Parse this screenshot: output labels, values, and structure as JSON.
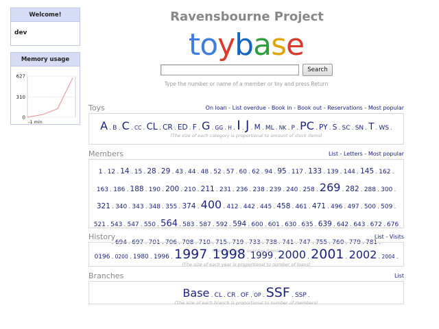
{
  "sidebar": {
    "welcome_title": "Welcome!",
    "user": "dev",
    "memory_title": "Memory usage"
  },
  "header": {
    "title": "Ravensbourne Project",
    "logo_letters": [
      "t",
      "o",
      "y",
      "b",
      "a",
      "s",
      "e"
    ],
    "logo_colors": [
      "#3f7de0",
      "#3f7de0",
      "#d93a2b",
      "#1565c0",
      "#2e9e3e",
      "#e0a400",
      "#d93a2b"
    ]
  },
  "search": {
    "value": "",
    "button_label": "Search",
    "hint": "Type the number or name of a member or toy and press Return"
  },
  "chart_data": {
    "type": "line",
    "title": "",
    "y_ticks": [
      "627",
      "310",
      "0"
    ],
    "x_ticks": [
      "-1 min"
    ],
    "ylim": [
      0,
      627
    ],
    "values": [
      0,
      40,
      130,
      600
    ]
  },
  "toys": {
    "title": "Toys",
    "links": [
      "On loan",
      "List overdue",
      "Book in",
      "Book out",
      "Reservations",
      "Most popular"
    ],
    "items": [
      {
        "t": "A",
        "s": 5
      },
      {
        "t": "B",
        "s": 2
      },
      {
        "t": "C",
        "s": 5
      },
      {
        "t": "CC",
        "s": 1
      },
      {
        "t": "CL",
        "s": 4
      },
      {
        "t": "CR",
        "s": 3
      },
      {
        "t": "ED",
        "s": 3
      },
      {
        "t": "F",
        "s": 3
      },
      {
        "t": "G",
        "s": 5
      },
      {
        "t": "GG",
        "s": 1
      },
      {
        "t": "H",
        "s": 1
      },
      {
        "t": "I",
        "s": 6
      },
      {
        "t": "J",
        "s": 6
      },
      {
        "t": "M",
        "s": 3
      },
      {
        "t": "ML",
        "s": 2
      },
      {
        "t": "NK",
        "s": 1
      },
      {
        "t": "P",
        "s": 2
      },
      {
        "t": "PC",
        "s": 5
      },
      {
        "t": "PY",
        "s": 3
      },
      {
        "t": "S",
        "s": 3
      },
      {
        "t": "SC",
        "s": 2
      },
      {
        "t": "SN",
        "s": 2
      },
      {
        "t": "T",
        "s": 4
      },
      {
        "t": "WS",
        "s": 2
      }
    ],
    "note": "(The size of each category is proportional to amount of stock items)"
  },
  "members": {
    "title": "Members",
    "links": [
      "List",
      "Letters",
      "Most popular"
    ],
    "items": [
      {
        "t": "1",
        "s": 2
      },
      {
        "t": "12",
        "s": 2
      },
      {
        "t": "14",
        "s": 3
      },
      {
        "t": "15",
        "s": 2
      },
      {
        "t": "28",
        "s": 3
      },
      {
        "t": "29",
        "s": 3
      },
      {
        "t": "43",
        "s": 2
      },
      {
        "t": "44",
        "s": 2
      },
      {
        "t": "48",
        "s": 2
      },
      {
        "t": "52",
        "s": 2
      },
      {
        "t": "57",
        "s": 2
      },
      {
        "t": "60",
        "s": 2
      },
      {
        "t": "62",
        "s": 2
      },
      {
        "t": "94",
        "s": 2
      },
      {
        "t": "95",
        "s": 3
      },
      {
        "t": "117",
        "s": 2
      },
      {
        "t": "133",
        "s": 3
      },
      {
        "t": "139",
        "s": 2
      },
      {
        "t": "144",
        "s": 2
      },
      {
        "t": "145",
        "s": 3
      },
      {
        "t": "162",
        "s": 2
      },
      {
        "t": "163",
        "s": 2
      },
      {
        "t": "186",
        "s": 2
      },
      {
        "t": "188",
        "s": 3
      },
      {
        "t": "190",
        "s": 2
      },
      {
        "t": "200",
        "s": 3
      },
      {
        "t": "210",
        "s": 2
      },
      {
        "t": "211",
        "s": 3
      },
      {
        "t": "231",
        "s": 2
      },
      {
        "t": "236",
        "s": 2
      },
      {
        "t": "238",
        "s": 2
      },
      {
        "t": "239",
        "s": 2
      },
      {
        "t": "240",
        "s": 2
      },
      {
        "t": "258",
        "s": 2
      },
      {
        "t": "269",
        "s": 5
      },
      {
        "t": "282",
        "s": 3
      },
      {
        "t": "288",
        "s": 2
      },
      {
        "t": "300",
        "s": 2
      },
      {
        "t": "321",
        "s": 3
      },
      {
        "t": "340",
        "s": 2
      },
      {
        "t": "343",
        "s": 2
      },
      {
        "t": "348",
        "s": 2
      },
      {
        "t": "355",
        "s": 2
      },
      {
        "t": "374",
        "s": 3
      },
      {
        "t": "400",
        "s": 5
      },
      {
        "t": "412",
        "s": 2
      },
      {
        "t": "442",
        "s": 2
      },
      {
        "t": "445",
        "s": 2
      },
      {
        "t": "458",
        "s": 3
      },
      {
        "t": "461",
        "s": 2
      },
      {
        "t": "471",
        "s": 3
      },
      {
        "t": "496",
        "s": 2
      },
      {
        "t": "497",
        "s": 2
      },
      {
        "t": "500",
        "s": 2
      },
      {
        "t": "509",
        "s": 2
      },
      {
        "t": "521",
        "s": 2
      },
      {
        "t": "543",
        "s": 2
      },
      {
        "t": "547",
        "s": 2
      },
      {
        "t": "550",
        "s": 2
      },
      {
        "t": "564",
        "s": 4
      },
      {
        "t": "583",
        "s": 2
      },
      {
        "t": "587",
        "s": 2
      },
      {
        "t": "592",
        "s": 2
      },
      {
        "t": "594",
        "s": 3
      },
      {
        "t": "600",
        "s": 2
      },
      {
        "t": "601",
        "s": 2
      },
      {
        "t": "630",
        "s": 2
      },
      {
        "t": "635",
        "s": 2
      },
      {
        "t": "639",
        "s": 3
      },
      {
        "t": "642",
        "s": 2
      },
      {
        "t": "643",
        "s": 2
      },
      {
        "t": "672",
        "s": 2
      },
      {
        "t": "676",
        "s": 2
      },
      {
        "t": "694",
        "s": 2
      },
      {
        "t": "697",
        "s": 2
      },
      {
        "t": "701",
        "s": 2
      },
      {
        "t": "706",
        "s": 2
      },
      {
        "t": "708",
        "s": 2
      },
      {
        "t": "710",
        "s": 2
      },
      {
        "t": "715",
        "s": 2
      },
      {
        "t": "719",
        "s": 2
      },
      {
        "t": "733",
        "s": 2
      },
      {
        "t": "738",
        "s": 2
      },
      {
        "t": "741",
        "s": 2
      },
      {
        "t": "747",
        "s": 2
      },
      {
        "t": "755",
        "s": 2
      },
      {
        "t": "760",
        "s": 2
      },
      {
        "t": "779",
        "s": 2
      },
      {
        "t": "781",
        "s": 2
      }
    ],
    "note": "(Members with overdue items)"
  },
  "history": {
    "title": "History",
    "links": [
      "List",
      "Visits"
    ],
    "items": [
      {
        "t": "0196",
        "s": 2
      },
      {
        "t": "0200",
        "s": 1
      },
      {
        "t": "1980",
        "s": 2
      },
      {
        "t": "1996",
        "s": 2
      },
      {
        "t": "1997",
        "s": 6
      },
      {
        "t": "1998",
        "s": 6
      },
      {
        "t": "1999",
        "s": 4
      },
      {
        "t": "2000",
        "s": 5
      },
      {
        "t": "2001",
        "s": 6
      },
      {
        "t": "2002",
        "s": 5
      },
      {
        "t": "2004",
        "s": 1
      }
    ],
    "note": "(The size of each year is proportional to number of loans)"
  },
  "branches": {
    "title": "Branches",
    "links": [
      "List"
    ],
    "items": [
      {
        "t": "Base",
        "s": 5
      },
      {
        "t": "CL",
        "s": 2
      },
      {
        "t": "CR",
        "s": 2
      },
      {
        "t": "OF",
        "s": 2
      },
      {
        "t": "OP",
        "s": 1
      },
      {
        "t": "SSF",
        "s": 6
      },
      {
        "t": "SSP",
        "s": 2
      }
    ],
    "note": "(The size of each branch is proportional to number of members)"
  }
}
